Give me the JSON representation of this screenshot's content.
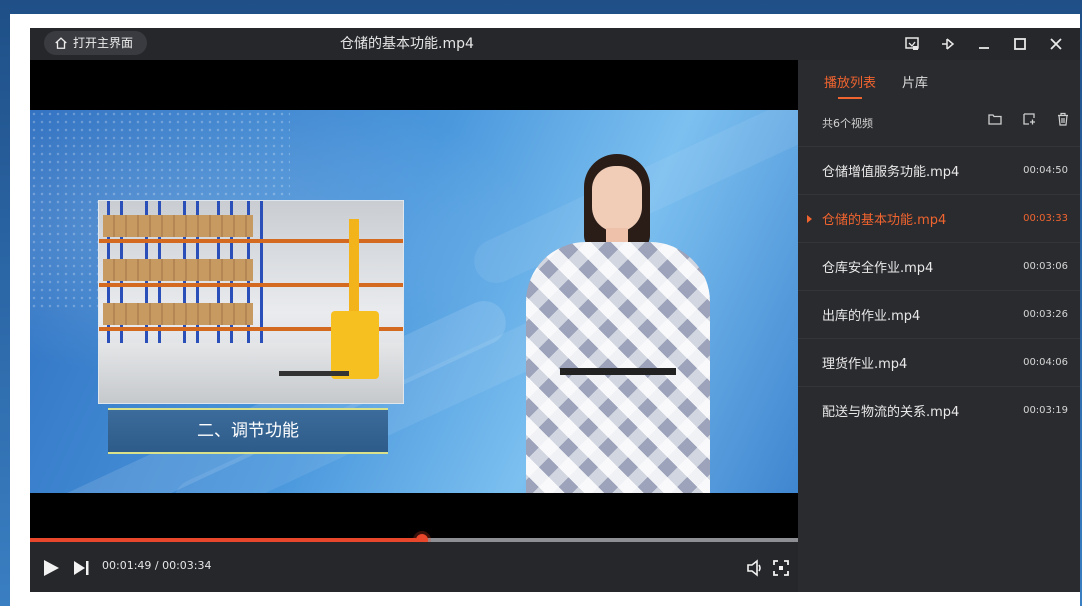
{
  "titlebar": {
    "home_label": "打开主界面",
    "title": "仓储的基本功能.mp4",
    "controls": [
      "screenshot-icon",
      "pin-icon",
      "minimize-icon",
      "maximize-icon",
      "close-icon"
    ]
  },
  "video": {
    "caption": "二、调节功能",
    "playback": {
      "time_text": "00:01:49 / 00:03:34",
      "progress_fraction": 0.51
    }
  },
  "playlist": {
    "tabs": [
      {
        "label": "播放列表",
        "active": true
      },
      {
        "label": "片库",
        "active": false
      }
    ],
    "count_text": "共6个视频",
    "items": [
      {
        "name": "仓储增值服务功能.mp4",
        "duration": "00:04:50",
        "playing": false
      },
      {
        "name": "仓储的基本功能.mp4",
        "duration": "00:03:33",
        "playing": true
      },
      {
        "name": "仓库安全作业.mp4",
        "duration": "00:03:06",
        "playing": false
      },
      {
        "name": "出库的作业.mp4",
        "duration": "00:03:26",
        "playing": false
      },
      {
        "name": "理货作业.mp4",
        "duration": "00:04:06",
        "playing": false
      },
      {
        "name": "配送与物流的关系.mp4",
        "duration": "00:03:19",
        "playing": false
      }
    ]
  },
  "colors": {
    "accent": "#f0642f",
    "progress": "#e8472b",
    "panel_bg": "#2a2b2f",
    "titlebar_bg": "#26272b"
  }
}
